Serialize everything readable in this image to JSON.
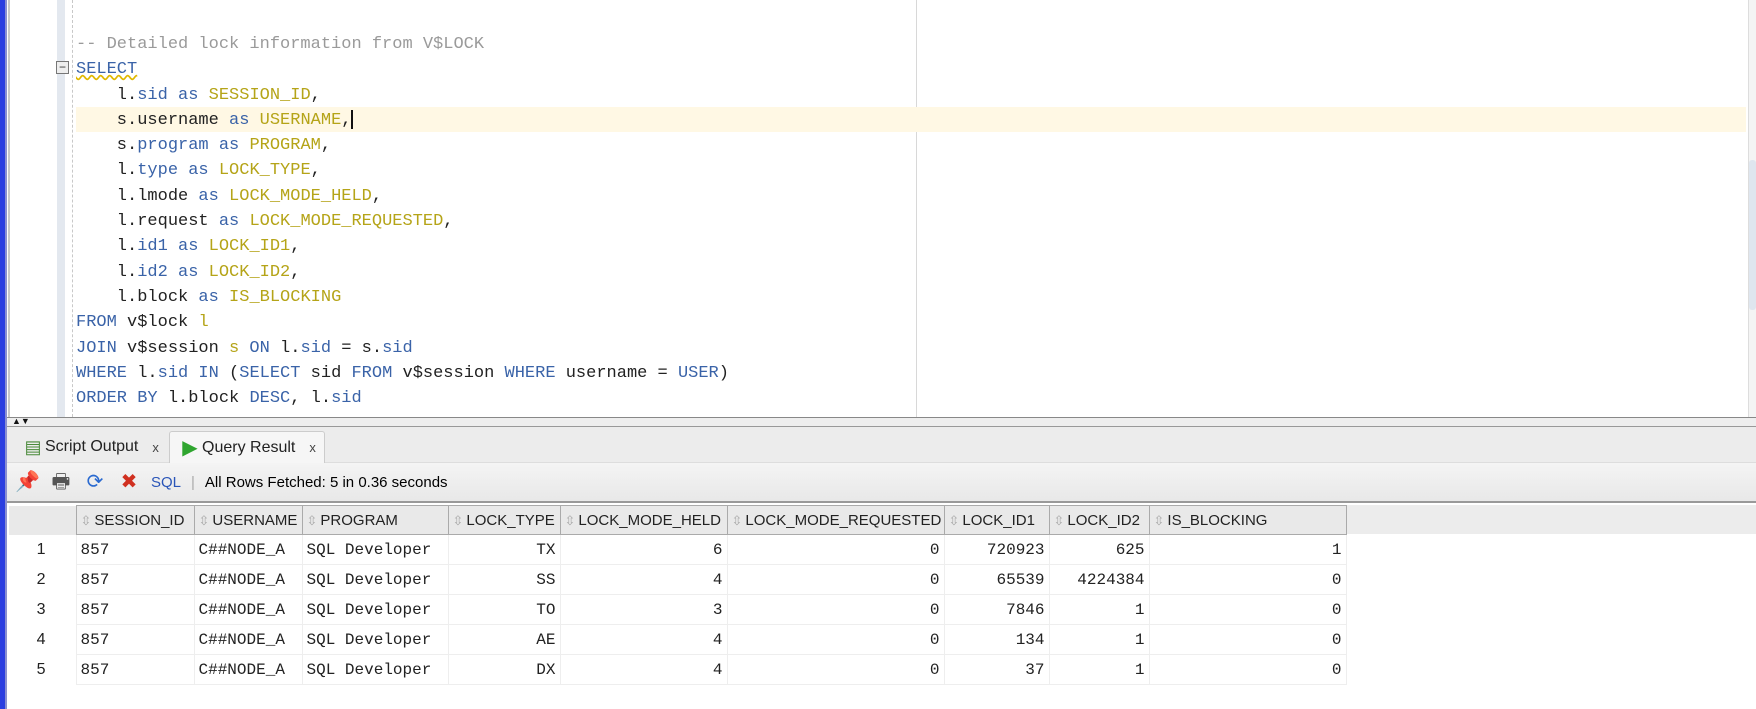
{
  "editor": {
    "lines": [
      [
        [
          "-- Detailed lock information from V$LOCK",
          "cm"
        ]
      ],
      [
        [
          "SELECT",
          "kw squig"
        ]
      ],
      [
        [
          "    l.",
          "pl"
        ],
        [
          "sid",
          "kw"
        ],
        [
          " as ",
          "kw"
        ],
        [
          "SESSION_ID",
          "al"
        ],
        [
          ",",
          "pl"
        ]
      ],
      [
        [
          "    s.",
          "pl"
        ],
        [
          "username",
          "pl"
        ],
        [
          " as ",
          "kw"
        ],
        [
          "USERNAME",
          "al"
        ],
        [
          ",",
          "pl"
        ]
      ],
      [
        [
          "    s.",
          "pl"
        ],
        [
          "program",
          "kw"
        ],
        [
          " as ",
          "kw"
        ],
        [
          "PROGRAM",
          "al"
        ],
        [
          ",",
          "pl"
        ]
      ],
      [
        [
          "    l.",
          "pl"
        ],
        [
          "type",
          "kw"
        ],
        [
          " as ",
          "kw"
        ],
        [
          "LOCK_TYPE",
          "al"
        ],
        [
          ",",
          "pl"
        ]
      ],
      [
        [
          "    l.",
          "pl"
        ],
        [
          "lmode",
          "pl"
        ],
        [
          " as ",
          "kw"
        ],
        [
          "LOCK_MODE_HELD",
          "al"
        ],
        [
          ",",
          "pl"
        ]
      ],
      [
        [
          "    l.",
          "pl"
        ],
        [
          "request",
          "pl"
        ],
        [
          " as ",
          "kw"
        ],
        [
          "LOCK_MODE_REQUESTED",
          "al"
        ],
        [
          ",",
          "pl"
        ]
      ],
      [
        [
          "    l.",
          "pl"
        ],
        [
          "id1",
          "kw"
        ],
        [
          " as ",
          "kw"
        ],
        [
          "LOCK_ID1",
          "al"
        ],
        [
          ",",
          "pl"
        ]
      ],
      [
        [
          "    l.",
          "pl"
        ],
        [
          "id2",
          "kw"
        ],
        [
          " as ",
          "kw"
        ],
        [
          "LOCK_ID2",
          "al"
        ],
        [
          ",",
          "pl"
        ]
      ],
      [
        [
          "    l.",
          "pl"
        ],
        [
          "block",
          "pl"
        ],
        [
          " as ",
          "kw"
        ],
        [
          "IS_BLOCKING",
          "al"
        ]
      ],
      [
        [
          "FROM",
          "kw"
        ],
        [
          " v$lock ",
          "pl"
        ],
        [
          "l",
          "al"
        ]
      ],
      [
        [
          "JOIN",
          "kw"
        ],
        [
          " v$session ",
          "pl"
        ],
        [
          "s",
          "al"
        ],
        [
          " ON ",
          "kw"
        ],
        [
          "l.",
          "pl"
        ],
        [
          "sid",
          "kw"
        ],
        [
          " = s.",
          "pl"
        ],
        [
          "sid",
          "kw"
        ]
      ],
      [
        [
          "WHERE",
          "kw"
        ],
        [
          " l.",
          "pl"
        ],
        [
          "sid",
          "kw"
        ],
        [
          " IN ",
          "kw"
        ],
        [
          "(",
          "pl"
        ],
        [
          "SELECT",
          "kw"
        ],
        [
          " sid ",
          "pl"
        ],
        [
          "FROM",
          "kw"
        ],
        [
          " v$session ",
          "pl"
        ],
        [
          "WHERE",
          "kw"
        ],
        [
          " username = ",
          "pl"
        ],
        [
          "USER",
          "kw"
        ],
        [
          ")",
          "pl"
        ]
      ],
      [
        [
          "ORDER BY",
          "kw"
        ],
        [
          " l.",
          "pl"
        ],
        [
          "block",
          "pl"
        ],
        [
          " DESC",
          "kw"
        ],
        [
          ", l.",
          "pl"
        ],
        [
          "sid",
          "kw"
        ]
      ]
    ],
    "caret_line": 3
  },
  "tabs": [
    {
      "label": "Script Output",
      "close": "x"
    },
    {
      "label": "Query Result",
      "close": "x"
    }
  ],
  "toolbar": {
    "sql_label": "SQL",
    "status": "All Rows Fetched: 5 in 0.36 seconds"
  },
  "grid": {
    "columns": [
      "SESSION_ID",
      "USERNAME",
      "PROGRAM",
      "LOCK_TYPE",
      "LOCK_MODE_HELD",
      "LOCK_MODE_REQUESTED",
      "LOCK_ID1",
      "LOCK_ID2",
      "IS_BLOCKING"
    ],
    "rows": [
      [
        "1",
        "857",
        "C##NODE_A",
        "SQL Developer",
        "TX",
        "6",
        "0",
        "720923",
        "625",
        "1"
      ],
      [
        "2",
        "857",
        "C##NODE_A",
        "SQL Developer",
        "SS",
        "4",
        "0",
        "65539",
        "4224384",
        "0"
      ],
      [
        "3",
        "857",
        "C##NODE_A",
        "SQL Developer",
        "TO",
        "3",
        "0",
        "7846",
        "1",
        "0"
      ],
      [
        "4",
        "857",
        "C##NODE_A",
        "SQL Developer",
        "AE",
        "4",
        "0",
        "134",
        "1",
        "0"
      ],
      [
        "5",
        "857",
        "C##NODE_A",
        "SQL Developer",
        "DX",
        "4",
        "0",
        "37",
        "1",
        "0"
      ]
    ]
  }
}
